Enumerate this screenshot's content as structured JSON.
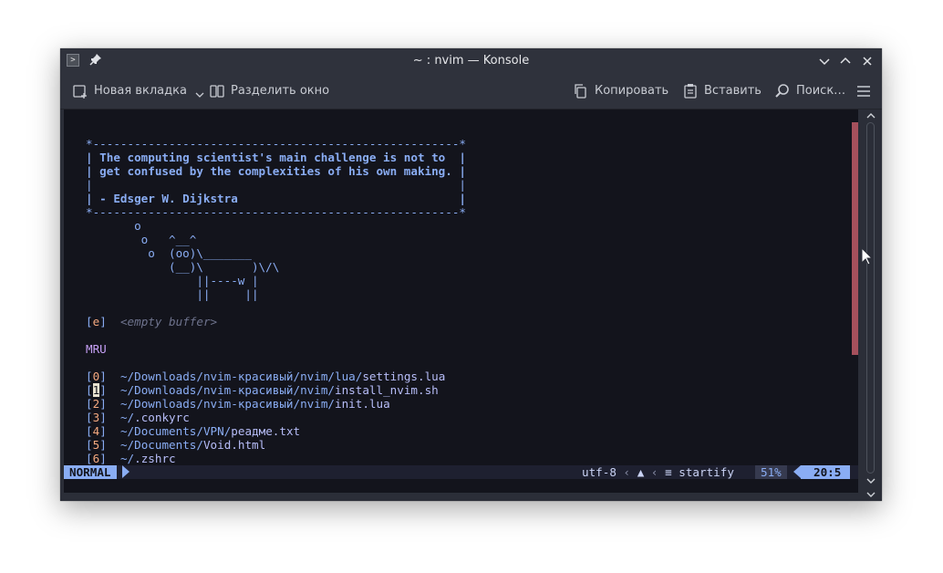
{
  "window": {
    "title": "~ : nvim — Konsole"
  },
  "icons": {
    "app": "terminal-app-icon",
    "pin": "pin-icon",
    "minimize": "chevron-down-icon",
    "maximize": "chevron-up-icon",
    "close": "close-icon"
  },
  "toolbar": {
    "new_tab_label": "Новая вкладка",
    "split_label": "Разделить окно",
    "copy_label": "Копировать",
    "paste_label": "Вставить",
    "find_label": "Поиск…"
  },
  "terminal": {
    "quote": {
      "border_top": "*-----------------------------------------------------*",
      "line1": "| The computing scientist's main challenge is not to  |",
      "line2": "| get confused by the complexities of his own making. |",
      "line3": "|                                                     |",
      "line4": "| - Edsger W. Dijkstra                                |",
      "border_bottom": "*-----------------------------------------------------*"
    },
    "cow": [
      "       o",
      "        o   ^__^",
      "         o  (oo)\\_______",
      "            (__)\\       )\\/\\",
      "                ||----w |",
      "                ||     ||"
    ],
    "empty_entry": {
      "key": "e",
      "label": "<empty buffer>"
    },
    "mru_header": "MRU",
    "mru_items": [
      {
        "key": "0",
        "dir": "~/Downloads/nvim-красивый/nvim/lua/",
        "file": "settings.lua"
      },
      {
        "key": "1",
        "dir": "~/Downloads/nvim-красивый/nvim/",
        "file": "install_nvim.sh"
      },
      {
        "key": "2",
        "dir": "~/Downloads/nvim-красивый/nvim/",
        "file": "init.lua"
      },
      {
        "key": "3",
        "dir": "~/",
        "file": ".conkyrc"
      },
      {
        "key": "4",
        "dir": "~/Documents/VPN/",
        "file": "реадме.txt"
      },
      {
        "key": "5",
        "dir": "~/Documents/",
        "file": "Void.html"
      },
      {
        "key": "6",
        "dir": "~/",
        "file": ".zshrc"
      }
    ],
    "statusline": {
      "mode": "NORMAL",
      "encoding": "utf-8",
      "filetype": "startify",
      "percent": "51%",
      "position": "20:5"
    }
  },
  "colors": {
    "terminal_bg": "#13141c",
    "accent_blue": "#8aadf4",
    "index_orange": "#f5a97f",
    "mru_purple": "#c6a0f6",
    "marker_red": "#a5505c"
  }
}
